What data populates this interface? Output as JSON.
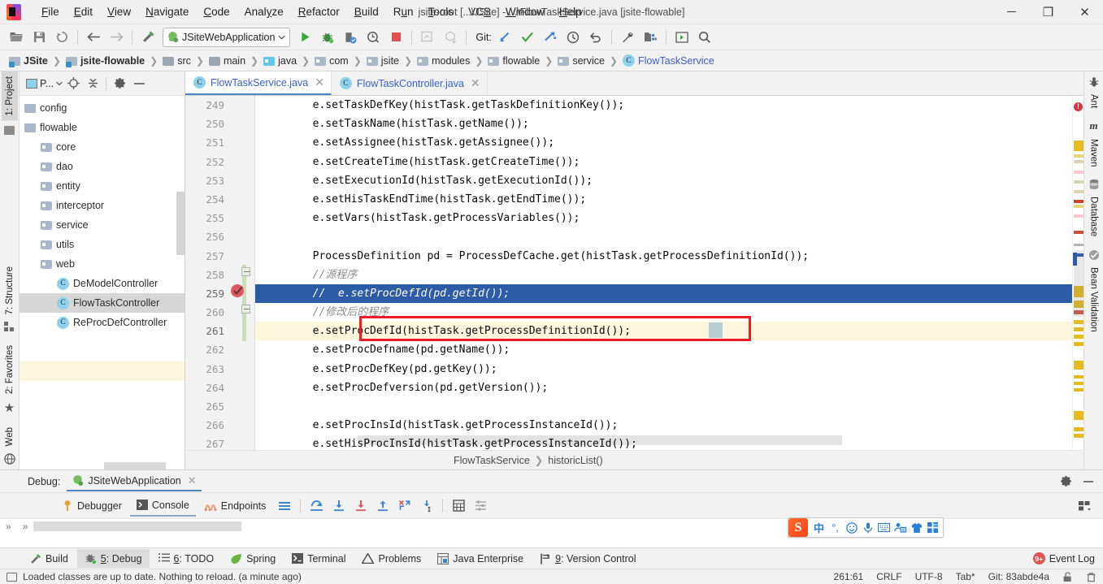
{
  "window": {
    "title": "jsite-root [...\\JSite] - ...\\FlowTaskService.java [jsite-flowable]",
    "minimize": "─",
    "maximize": "❐",
    "close": "✕"
  },
  "menu": [
    "File",
    "Edit",
    "View",
    "Navigate",
    "Code",
    "Analyze",
    "Refactor",
    "Build",
    "Run",
    "Tools",
    "VCS",
    "Window",
    "Help"
  ],
  "toolbar": {
    "run_config": "JSiteWebApplication",
    "git_label": "Git:"
  },
  "breadcrumb": [
    {
      "label": "JSite",
      "icon": "module-icon",
      "bold": true
    },
    {
      "label": "jsite-flowable",
      "icon": "module-icon",
      "bold": true
    },
    {
      "label": "src",
      "icon": "folder-icon",
      "bold": false
    },
    {
      "label": "main",
      "icon": "folder-icon",
      "bold": false
    },
    {
      "label": "java",
      "icon": "folder-source-icon",
      "bold": false
    },
    {
      "label": "com",
      "icon": "folder-icon",
      "bold": false
    },
    {
      "label": "jsite",
      "icon": "folder-icon",
      "bold": false
    },
    {
      "label": "modules",
      "icon": "folder-icon",
      "bold": false
    },
    {
      "label": "flowable",
      "icon": "folder-icon",
      "bold": false
    },
    {
      "label": "service",
      "icon": "folder-icon",
      "bold": false
    },
    {
      "label": "FlowTaskService",
      "icon": "class-icon",
      "bold": false
    }
  ],
  "left_strip": [
    {
      "label": "1: Project",
      "selected": true
    },
    {
      "label": "7: Structure",
      "selected": false
    },
    {
      "label": "2: Favorites",
      "selected": false
    },
    {
      "label": "Web",
      "selected": false
    }
  ],
  "right_strip": [
    {
      "label": "Ant"
    },
    {
      "label": "Maven"
    },
    {
      "label": "Database"
    },
    {
      "label": "Bean Validation"
    }
  ],
  "project_pane": {
    "title": "P...",
    "tree": [
      {
        "label": "config",
        "icon": "module-icon",
        "indent": 1,
        "selected": false
      },
      {
        "label": "flowable",
        "icon": "module-icon",
        "indent": 1,
        "selected": false
      },
      {
        "label": "core",
        "icon": "folder-icon",
        "indent": 2,
        "selected": false
      },
      {
        "label": "dao",
        "icon": "folder-icon",
        "indent": 2,
        "selected": false
      },
      {
        "label": "entity",
        "icon": "folder-icon",
        "indent": 2,
        "selected": false
      },
      {
        "label": "interceptor",
        "icon": "folder-icon",
        "indent": 2,
        "selected": false
      },
      {
        "label": "service",
        "icon": "folder-icon",
        "indent": 2,
        "selected": false
      },
      {
        "label": "utils",
        "icon": "folder-icon",
        "indent": 2,
        "selected": false
      },
      {
        "label": "web",
        "icon": "folder-icon",
        "indent": 2,
        "selected": false
      },
      {
        "label": "DeModelController",
        "icon": "class-icon",
        "indent": 3,
        "selected": false
      },
      {
        "label": "FlowTaskController",
        "icon": "class-icon",
        "indent": 3,
        "selected": true
      },
      {
        "label": "ReProcDefController",
        "icon": "class-icon",
        "indent": 3,
        "selected": false
      }
    ]
  },
  "editor": {
    "tabs": [
      {
        "label": "FlowTaskService.java",
        "active": true
      },
      {
        "label": "FlowTaskController.java",
        "active": false
      }
    ],
    "first_line": 249,
    "lines": [
      {
        "n": 249,
        "text": "        e.setTaskDefKey(histTask.getTaskDefinitionKey());",
        "style": "normal"
      },
      {
        "n": 250,
        "text": "        e.setTaskName(histTask.getName());",
        "style": "normal"
      },
      {
        "n": 251,
        "text": "        e.setAssignee(histTask.getAssignee());",
        "style": "normal"
      },
      {
        "n": 252,
        "text": "        e.setCreateTime(histTask.getCreateTime());",
        "style": "normal"
      },
      {
        "n": 253,
        "text": "        e.setExecutionId(histTask.getExecutionId());",
        "style": "normal"
      },
      {
        "n": 254,
        "text": "        e.setHisTaskEndTime(histTask.getEndTime());",
        "style": "normal"
      },
      {
        "n": 255,
        "text": "        e.setVars(histTask.getProcessVariables());",
        "style": "normal"
      },
      {
        "n": 256,
        "text": "",
        "style": "normal"
      },
      {
        "n": 257,
        "text": "        ProcessDefinition pd = ProcessDefCache.get(histTask.getProcessDefinitionId());",
        "style": "normal"
      },
      {
        "n": 258,
        "text": "        //源程序",
        "style": "comment"
      },
      {
        "n": 259,
        "text": "        //  e.setProcDefId(pd.getId());",
        "style": "comment-selected"
      },
      {
        "n": 260,
        "text": "        //修改后的程序",
        "style": "comment"
      },
      {
        "n": 261,
        "text": "        e.setProcDefId(histTask.getProcessDefinitionId());",
        "style": "highlighted-boxed"
      },
      {
        "n": 262,
        "text": "        e.setProcDefname(pd.getName());",
        "style": "normal"
      },
      {
        "n": 263,
        "text": "        e.setProcDefKey(pd.getKey());",
        "style": "normal"
      },
      {
        "n": 264,
        "text": "        e.setProcDefversion(pd.getVersion());",
        "style": "normal"
      },
      {
        "n": 265,
        "text": "",
        "style": "normal"
      },
      {
        "n": 266,
        "text": "        e.setProcInsId(histTask.getProcessInstanceId());",
        "style": "normal"
      },
      {
        "n": 267,
        "text": "        e.setHisProcInsId(histTask.getProcessInstanceId());",
        "style": "normal"
      }
    ],
    "breakpoint_line": 259,
    "bottom_breadcrumb": [
      "FlowTaskService",
      "historicList()"
    ]
  },
  "debug_panel": {
    "label": "Debug:",
    "session": "JSiteWebApplication",
    "tabs": [
      {
        "label": "Debugger",
        "selected": false
      },
      {
        "label": "Console",
        "selected": true
      },
      {
        "label": "Endpoints",
        "selected": false
      }
    ]
  },
  "ime": {
    "name": "sogou-ime",
    "mode": "中",
    "items": [
      "logo",
      "中",
      "punctuation",
      "emoji",
      "voice",
      "keyboard",
      "handwriting",
      "skin",
      "apps"
    ]
  },
  "tool_strip": [
    {
      "label": "Build",
      "selected": false,
      "icon": "hammer-icon"
    },
    {
      "label": "5: Debug",
      "selected": true,
      "icon": "bug-icon"
    },
    {
      "label": "6: TODO",
      "selected": false,
      "icon": "list-icon"
    },
    {
      "label": "Spring",
      "selected": false,
      "icon": "spring-leaf-icon"
    },
    {
      "label": "Terminal",
      "selected": false,
      "icon": "terminal-icon"
    },
    {
      "label": "Problems",
      "selected": false,
      "icon": "warning-icon"
    },
    {
      "label": "Java Enterprise",
      "selected": false,
      "icon": "java-ee-icon"
    },
    {
      "label": "9: Version Control",
      "selected": false,
      "icon": "branch-icon"
    }
  ],
  "event_log": {
    "label": "Event Log",
    "badge": "9+"
  },
  "status_bar": {
    "message": "Loaded classes are up to date. Nothing to reload. (a minute ago)",
    "caret": "261:61",
    "line_sep": "CRLF",
    "encoding": "UTF-8",
    "indent": "Tab*",
    "git_branch": "Git: 83abde4a"
  },
  "colors": {
    "accent_blue": "#2d5ca6",
    "tab_link": "#3a5fcd",
    "highlight_yellow": "#fdf6dd",
    "error_red": "#d9333f",
    "box_red": "#ee1c25",
    "comment_gray": "#8c8c8c",
    "selection_gray": "#d6d6d6"
  }
}
